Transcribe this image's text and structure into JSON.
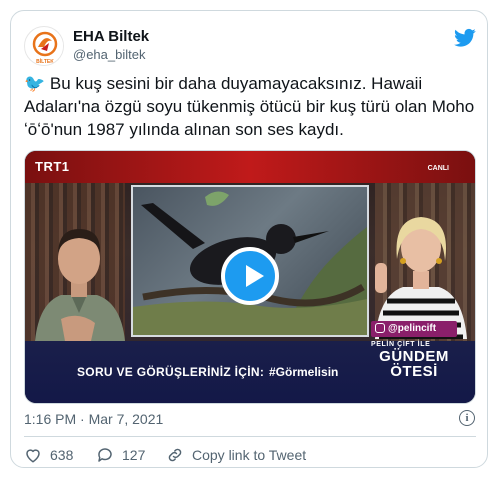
{
  "tweet": {
    "author_name": "EHA Biltek",
    "author_handle": "@eha_biltek",
    "avatar_text": "BİLTEK",
    "bird_emoji": "🐦",
    "text": "Bu kuş sesini bir daha duyamayacaksınız. Hawaii Adaları'na özgü soyu tükenmiş ötücü bir kuş türü olan Moho ʻōʻō'nun 1987 yılında alınan son ses kaydı.",
    "timestamp": "1:16 PM · Mar 7, 2021",
    "likes": "638",
    "replies": "127",
    "copy_link_label": "Copy link to Tweet",
    "info_glyph": "i"
  },
  "video": {
    "channel": "TRT1",
    "live_label": "CANLI",
    "ticker_text": "SORU VE GÖRÜŞLERİNİZ İÇİN:",
    "hashtag": "#Görmelisin",
    "instagram": "@pelincift",
    "show_host": "PELİN ÇİFT İLE",
    "show_title_1": "GÜNDEM",
    "show_title_2": "ÖTESİ"
  },
  "colors": {
    "accent": "#1d9bf0",
    "trt_red": "#c01a1a",
    "ticker_bg": "#131848"
  }
}
